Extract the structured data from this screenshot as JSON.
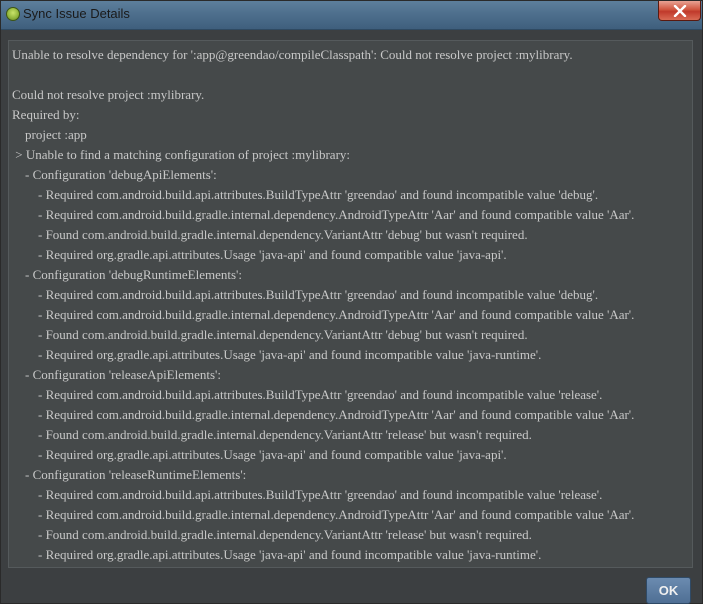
{
  "window": {
    "title": "Sync Issue Details",
    "app_icon": "android-studio-icon",
    "close_icon": "close-icon"
  },
  "message": {
    "lines": [
      "Unable to resolve dependency for ':app@greendao/compileClasspath': Could not resolve project :mylibrary.",
      "",
      "Could not resolve project :mylibrary.",
      "Required by:",
      "    project :app",
      " > Unable to find a matching configuration of project :mylibrary:",
      "    - Configuration 'debugApiElements':",
      "        - Required com.android.build.api.attributes.BuildTypeAttr 'greendao' and found incompatible value 'debug'.",
      "        - Required com.android.build.gradle.internal.dependency.AndroidTypeAttr 'Aar' and found compatible value 'Aar'.",
      "        - Found com.android.build.gradle.internal.dependency.VariantAttr 'debug' but wasn't required.",
      "        - Required org.gradle.api.attributes.Usage 'java-api' and found compatible value 'java-api'.",
      "    - Configuration 'debugRuntimeElements':",
      "        - Required com.android.build.api.attributes.BuildTypeAttr 'greendao' and found incompatible value 'debug'.",
      "        - Required com.android.build.gradle.internal.dependency.AndroidTypeAttr 'Aar' and found compatible value 'Aar'.",
      "        - Found com.android.build.gradle.internal.dependency.VariantAttr 'debug' but wasn't required.",
      "        - Required org.gradle.api.attributes.Usage 'java-api' and found incompatible value 'java-runtime'.",
      "    - Configuration 'releaseApiElements':",
      "        - Required com.android.build.api.attributes.BuildTypeAttr 'greendao' and found incompatible value 'release'.",
      "        - Required com.android.build.gradle.internal.dependency.AndroidTypeAttr 'Aar' and found compatible value 'Aar'.",
      "        - Found com.android.build.gradle.internal.dependency.VariantAttr 'release' but wasn't required.",
      "        - Required org.gradle.api.attributes.Usage 'java-api' and found compatible value 'java-api'.",
      "    - Configuration 'releaseRuntimeElements':",
      "        - Required com.android.build.api.attributes.BuildTypeAttr 'greendao' and found incompatible value 'release'.",
      "        - Required com.android.build.gradle.internal.dependency.AndroidTypeAttr 'Aar' and found compatible value 'Aar'.",
      "        - Found com.android.build.gradle.internal.dependency.VariantAttr 'release' but wasn't required.",
      "        - Required org.gradle.api.attributes.Usage 'java-api' and found incompatible value 'java-runtime'."
    ]
  },
  "buttons": {
    "ok_label": "OK"
  },
  "colors": {
    "background": "#3c3f41",
    "text": "#c8c8c8",
    "ok_button": "#5a7ca2"
  }
}
